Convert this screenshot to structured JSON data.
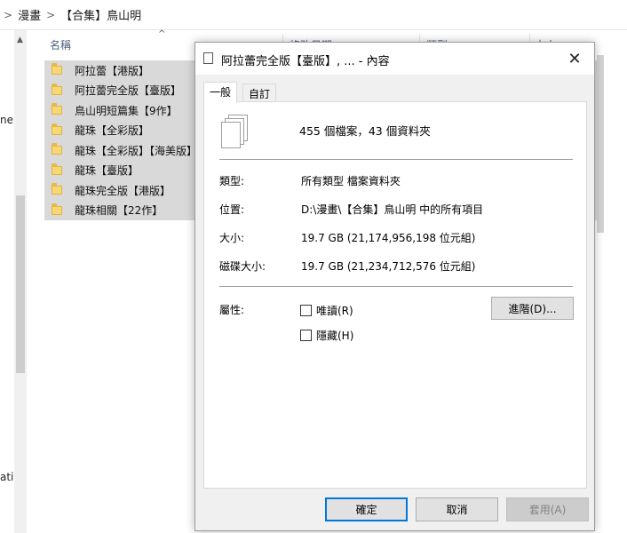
{
  "explorer": {
    "breadcrumb": [
      "漫畫",
      "【合集】鳥山明"
    ],
    "nav_labels": [
      "ne",
      "atir"
    ],
    "columns": [
      "名稱",
      "修改日期",
      "類型",
      "大小"
    ],
    "files": [
      "阿拉蕾【港版】",
      "阿拉蕾完全版【臺版】",
      "鳥山明短篇集【9作】",
      "龍珠【全彩版】",
      "龍珠【全彩版】【海美版】",
      "龍珠【臺版】",
      "龍珠完全版【港版】",
      "龍珠相關【22作】"
    ]
  },
  "dialog": {
    "title": "阿拉蕾完全版【臺版】, ... - 內容",
    "tabs": [
      "一般",
      "自訂"
    ],
    "summary": "455 個檔案，43 個資料夾",
    "properties": [
      {
        "label": "類型:",
        "value": "所有類型 檔案資料夾"
      },
      {
        "label": "位置:",
        "value": "D:\\漫畫\\【合集】鳥山明 中的所有項目"
      },
      {
        "label": "大小:",
        "value": "19.7 GB (21,174,956,198 位元組)"
      },
      {
        "label": "磁碟大小:",
        "value": "19.7 GB (21,234,712,576 位元組)"
      }
    ],
    "attributes_label": "屬性:",
    "readonly_label": "唯讀(R)",
    "hidden_label": "隱藏(H)",
    "advanced_label": "進階(D)...",
    "ok_label": "確定",
    "cancel_label": "取消",
    "apply_label": "套用(A)"
  },
  "colors": {
    "selection": "#d9d9d9",
    "folder": "#f8d775",
    "default_button_border": "#0078d7"
  }
}
